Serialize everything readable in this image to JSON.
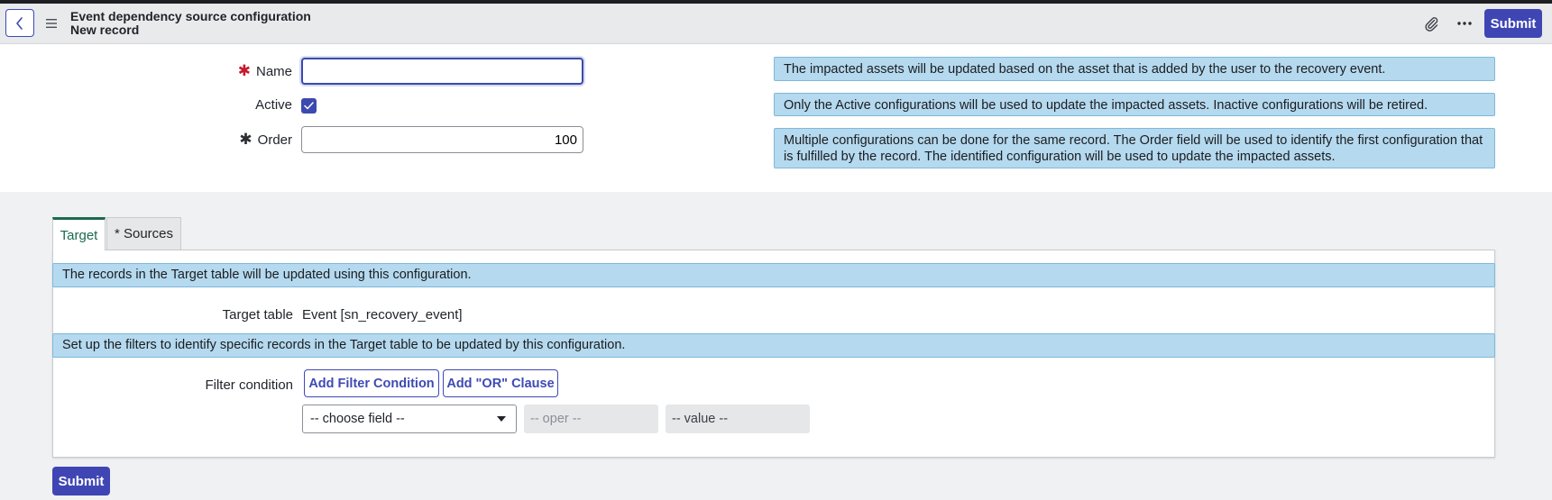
{
  "header": {
    "title": "Event dependency source configuration",
    "subtitle": "New record",
    "submit_label": "Submit",
    "icons": [
      "chevron-left-icon",
      "hamburger-menu-icon",
      "paperclip-icon",
      "more-horizontal-icon"
    ]
  },
  "form": {
    "name": {
      "label": "Name",
      "value": "",
      "required": true
    },
    "active": {
      "label": "Active",
      "checked": true
    },
    "order": {
      "label": "Order",
      "value": "100",
      "required": true
    }
  },
  "info_messages": [
    "The impacted assets will be updated based on the asset that is added by the user to the recovery event.",
    "Only the Active configurations will be used to update the impacted assets. Inactive configurations will be retired.",
    "Multiple configurations can be done for the same record. The Order field will be used to identify the first configuration that is fulfilled by the record. The identified configuration will be used to update the impacted assets."
  ],
  "tabs": [
    {
      "label": "Target",
      "active": true
    },
    {
      "label": "* Sources",
      "active": false
    }
  ],
  "target_panel": {
    "banner1": "The records in the Target table will be updated using this configuration.",
    "target_table_label": "Target table",
    "target_table_value": "Event [sn_recovery_event]",
    "banner2": "Set up the filters to identify specific records in the Target table to be updated by this configuration.",
    "filter_condition_label": "Filter condition",
    "add_filter_label": "Add Filter Condition",
    "add_or_label": "Add \"OR\" Clause",
    "field_placeholder": "-- choose field --",
    "oper_placeholder": "-- oper --",
    "value_placeholder": "-- value --"
  },
  "footer": {
    "submit_label": "Submit"
  },
  "colors": {
    "brand": "#3f46b4",
    "info_bg": "#b5d9ee",
    "active_tab": "#1a6a4e",
    "required": "#c51b2c"
  }
}
